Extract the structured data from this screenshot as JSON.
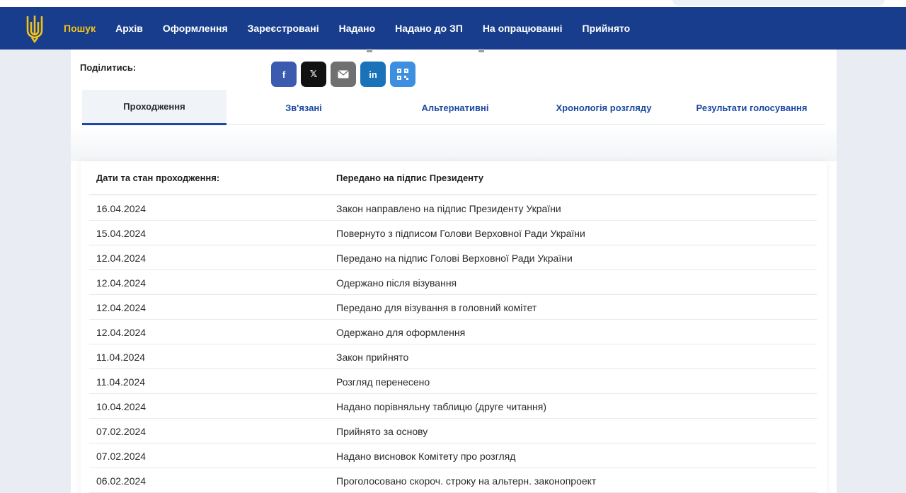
{
  "nav": {
    "items": [
      {
        "label": "Пошук",
        "active": true
      },
      {
        "label": "Архів"
      },
      {
        "label": "Оформлення"
      },
      {
        "label": "Зареєстровані"
      },
      {
        "label": "Надано"
      },
      {
        "label": "Надано до ЗП"
      },
      {
        "label": "На опрацюванні"
      },
      {
        "label": "Прийнято"
      }
    ]
  },
  "share": {
    "label": "Поділитись:",
    "buttons": [
      {
        "icon": "facebook-icon",
        "glyph": "f",
        "color": "#3b5bb0"
      },
      {
        "icon": "x-icon",
        "glyph": "𝕏",
        "color": "#111111"
      },
      {
        "icon": "email-icon",
        "glyph": "",
        "color": "#707070"
      },
      {
        "icon": "linkedin-icon",
        "glyph": "in",
        "color": "#1a73b8"
      },
      {
        "icon": "qr-code-icon",
        "glyph": "",
        "color": "#3e8fe0"
      }
    ]
  },
  "tabs": [
    {
      "label": "Проходження",
      "active": true
    },
    {
      "label": "Зв'язані"
    },
    {
      "label": "Альтернативні"
    },
    {
      "label": "Хронологія розгляду"
    },
    {
      "label": "Результати голосування"
    }
  ],
  "table": {
    "header_left": "Дати та стан проходження:",
    "header_right": "Передано на підпис Президенту",
    "rows": [
      {
        "date": "16.04.2024",
        "status": "Закон направлено на підпис Президенту України"
      },
      {
        "date": "15.04.2024",
        "status": "Повернуто з підписом Голови Верховної Ради України"
      },
      {
        "date": "12.04.2024",
        "status": "Передано на підпис Голові Верховної Ради України"
      },
      {
        "date": "12.04.2024",
        "status": "Одержано після візування"
      },
      {
        "date": "12.04.2024",
        "status": "Передано для візування в головний комітет"
      },
      {
        "date": "12.04.2024",
        "status": "Одержано для оформлення"
      },
      {
        "date": "11.04.2024",
        "status": "Закон прийнято"
      },
      {
        "date": "11.04.2024",
        "status": "Розгляд перенесено"
      },
      {
        "date": "10.04.2024",
        "status": "Надано порівняльну таблицю (друге читання)"
      },
      {
        "date": "07.02.2024",
        "status": "Прийнято за основу"
      },
      {
        "date": "07.02.2024",
        "status": "Надано висновок Комітету про розгляд"
      },
      {
        "date": "06.02.2024",
        "status": "Проголосовано скороч. строку на альтерн. законопроект"
      }
    ]
  },
  "colors": {
    "topbar": "#173d8c",
    "active_nav": "#f3c218",
    "tab_text": "#1c4aa3"
  }
}
